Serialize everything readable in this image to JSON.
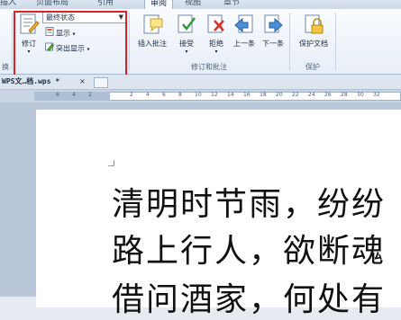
{
  "tabs": [
    {
      "label": "插入",
      "active": false
    },
    {
      "label": "页面布局",
      "active": false
    },
    {
      "label": "引用",
      "active": false
    },
    {
      "label": "审阅",
      "active": true
    },
    {
      "label": "视图",
      "active": false
    },
    {
      "label": "章节",
      "active": false
    }
  ],
  "ribbon": {
    "track_changes": {
      "label": "修订"
    },
    "status_dropdown": {
      "value": "最终状态"
    },
    "show_button": {
      "label": "显示"
    },
    "highlight_button": {
      "label": "突出显示"
    },
    "insert_comment": {
      "label": "插入批注"
    },
    "accept": {
      "label": "接受"
    },
    "reject": {
      "label": "拒绝"
    },
    "previous": {
      "label": "上一条"
    },
    "next": {
      "label": "下一条"
    },
    "protect_doc": {
      "label": "保护文档"
    },
    "groups": {
      "left_partial": "换",
      "revisions_comments": "修订和批注",
      "protect": "保护"
    }
  },
  "doc_tab": {
    "title": "WPS文…档.wps *",
    "close": "×"
  },
  "ruler": {
    "numbers": [
      "6",
      "4",
      "2",
      "2",
      "4",
      "6",
      "8",
      "10",
      "12",
      "14",
      "16",
      "18",
      "20",
      "22",
      "24",
      "26",
      "28",
      "30",
      "32"
    ]
  },
  "document": {
    "lines": [
      "清明时节雨，纷纷",
      "路上行人，欲断魂",
      "借问酒家，何处有"
    ]
  },
  "colors": {
    "highlight": "#d9232b",
    "ribbon_bg": "#eef3f9"
  }
}
